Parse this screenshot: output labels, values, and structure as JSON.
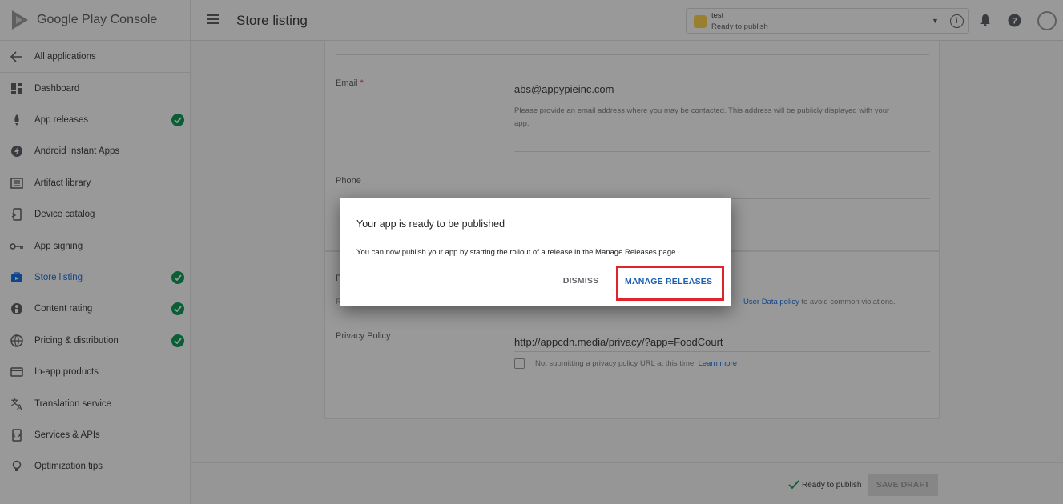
{
  "brand": {
    "name": "Google Play Console"
  },
  "header": {
    "title": "Store listing",
    "app_selector": {
      "name": "test",
      "status": "Ready to publish"
    }
  },
  "sidebar": {
    "all_apps": "All applications",
    "items": [
      {
        "label": "Dashboard",
        "icon": "dashboard-icon",
        "checked": false
      },
      {
        "label": "App releases",
        "icon": "rocket-icon",
        "checked": true
      },
      {
        "label": "Android Instant Apps",
        "icon": "bolt-icon",
        "checked": false
      },
      {
        "label": "Artifact library",
        "icon": "library-icon",
        "checked": false
      },
      {
        "label": "Device catalog",
        "icon": "device-icon",
        "checked": false
      },
      {
        "label": "App signing",
        "icon": "key-icon",
        "checked": false
      },
      {
        "label": "Store listing",
        "icon": "store-icon",
        "checked": true,
        "active": true
      },
      {
        "label": "Content rating",
        "icon": "rating-icon",
        "checked": true
      },
      {
        "label": "Pricing & distribution",
        "icon": "globe-icon",
        "checked": true
      },
      {
        "label": "In-app products",
        "icon": "card-icon",
        "checked": false
      },
      {
        "label": "Translation service",
        "icon": "translate-icon",
        "checked": false
      },
      {
        "label": "Services & APIs",
        "icon": "api-icon",
        "checked": false
      },
      {
        "label": "Optimization tips",
        "icon": "bulb-icon",
        "checked": false
      }
    ]
  },
  "form": {
    "email": {
      "label": "Email",
      "required_mark": "*",
      "value": "abs@appypieinc.com",
      "help_line1": "Please provide an email address where you may be contacted. This address will be publicly displayed with your",
      "help_line2": "app."
    },
    "phone": {
      "label": "Phone"
    },
    "policy_section": {
      "label_partial": "P",
      "help_partial": "R",
      "help_link": "User Data policy",
      "help_tail": "to avoid common violations."
    },
    "privacy_policy": {
      "label": "Privacy Policy",
      "value": "http://appcdn.media/privacy/?app=FoodCourt",
      "checkbox_label": "Not submitting a privacy policy URL at this time.",
      "learn_more": "Learn more"
    }
  },
  "footer": {
    "status": "Ready to publish",
    "save_label": "SAVE DRAFT"
  },
  "dialog": {
    "title": "Your app is ready to be published",
    "body": "You can now publish your app by starting the rollout of a release in the Manage Releases page.",
    "dismiss_label": "DISMISS",
    "manage_label": "MANAGE RELEASES"
  },
  "colors": {
    "check_green": "#0f9d58",
    "link_blue": "#1a73e8",
    "highlight_red": "#e0242b",
    "dialog_button_blue": "#1a5fb4"
  }
}
